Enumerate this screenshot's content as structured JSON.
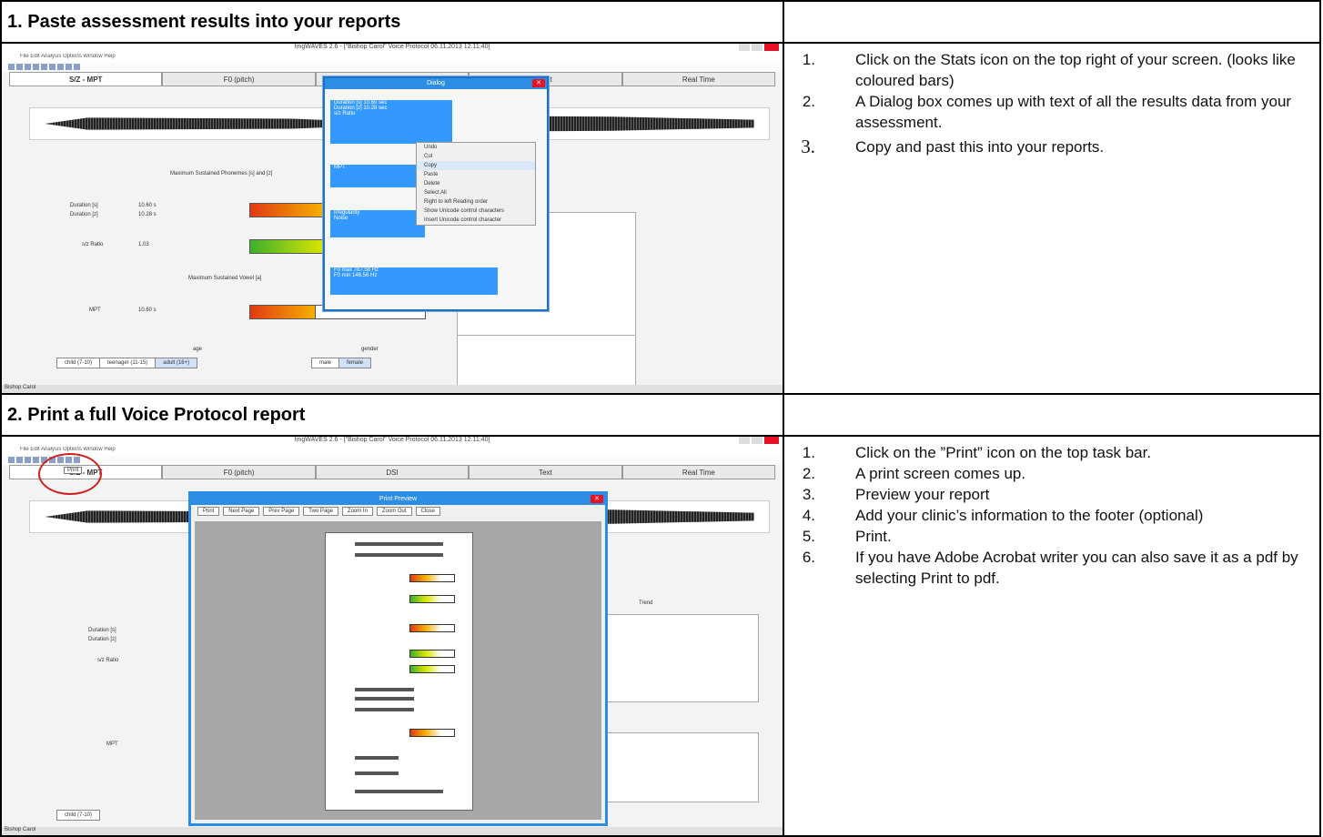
{
  "section1": {
    "title": "1. Paste assessment results into your reports",
    "screenshot": {
      "app_title": "ImgWAVES 2.6 - [\"Bishop Carol\" Voice Protocol 06.11.2013 12:11:40]",
      "menu": "File  Edit  Analysis  Options  Window  Help",
      "tabs": [
        "S/Z - MPT",
        "F0 (pitch)",
        "DSI",
        "Text",
        "Real Time"
      ],
      "dialog_title": "Dialog",
      "dialog_rows": [
        "Duration [s]   10.60  sec",
        "Duration [z]   10.28  sec",
        "s/z Ratio",
        "MPT",
        "Irregularity",
        "Noise",
        "F0 max  787.58  Hz",
        "F0 min  146.56  Hz"
      ],
      "context_menu": [
        "Undo",
        "Cut",
        "Copy",
        "Paste",
        "Delete",
        "Select All",
        "Right to left Reading order",
        "Show Unicode control characters",
        "Insert Unicode control character"
      ],
      "labels": {
        "mpt_heading": "Maximum Sustained Phonemes [s] and [z]",
        "vowel_heading": "Maximum Sustained Vowel [a]",
        "dur_s": "Duration [s]",
        "dur_s_val": "10.60 s",
        "dur_z": "Duration [z]",
        "dur_z_val": "10.28 s",
        "sz": "s/z Ratio",
        "sz_val": "1.03",
        "mpt": "MPT",
        "mpt_val": "10.60 s",
        "age": "age",
        "gender": "gender",
        "status": "Bishop Carol"
      },
      "age_buttons": [
        "child (7-10)",
        "teenager (11-15)",
        "adult (16+)"
      ],
      "gender_buttons": [
        "male",
        "female"
      ]
    },
    "steps": [
      {
        "num": "1.",
        "text": "Click on the Stats icon on the top right of your screen. (looks like coloured bars)"
      },
      {
        "num": "2.",
        "text": " A Dialog box comes up with text of all the results data from your assessment."
      },
      {
        "num": "3.",
        "text": "Copy and past this into your reports."
      }
    ]
  },
  "section2": {
    "title": "2. Print a full Voice Protocol report",
    "screenshot": {
      "app_title": "ImgWAVES 2.6 - [\"Bishop Carol\" Voice Protocol 06.11.2013 12:11:40]",
      "print_button": "Print",
      "tabs": [
        "S/Z - MPT",
        "F0 (pitch)",
        "DSI",
        "Text",
        "Real Time"
      ],
      "preview_title": "Print Preview",
      "preview_buttons": [
        "Print",
        "Next Page",
        "Prev Page",
        "Two Page",
        "Zoom In",
        "Zoom Out",
        "Close"
      ],
      "labels": {
        "dur_s": "Duration [s]",
        "dur_z": "Duration [z]",
        "sz": "s/z Ratio",
        "mpt": "MPT",
        "trend": "Trend",
        "status": "Bishop Carol",
        "child": "child (7-10)"
      }
    },
    "steps": [
      {
        "num": "1.",
        "text": "Click on the ”Print” icon on the top task bar."
      },
      {
        "num": "2.",
        "text": "A print screen comes up."
      },
      {
        "num": "3.",
        "text": "Preview your report"
      },
      {
        "num": "4.",
        "text": "Add your clinic’s information to the footer (optional)"
      },
      {
        "num": "5.",
        "text": "Print."
      },
      {
        "num": "6.",
        "text": "If you have Adobe Acrobat writer you can also save it as a pdf by selecting Print to pdf."
      }
    ]
  }
}
